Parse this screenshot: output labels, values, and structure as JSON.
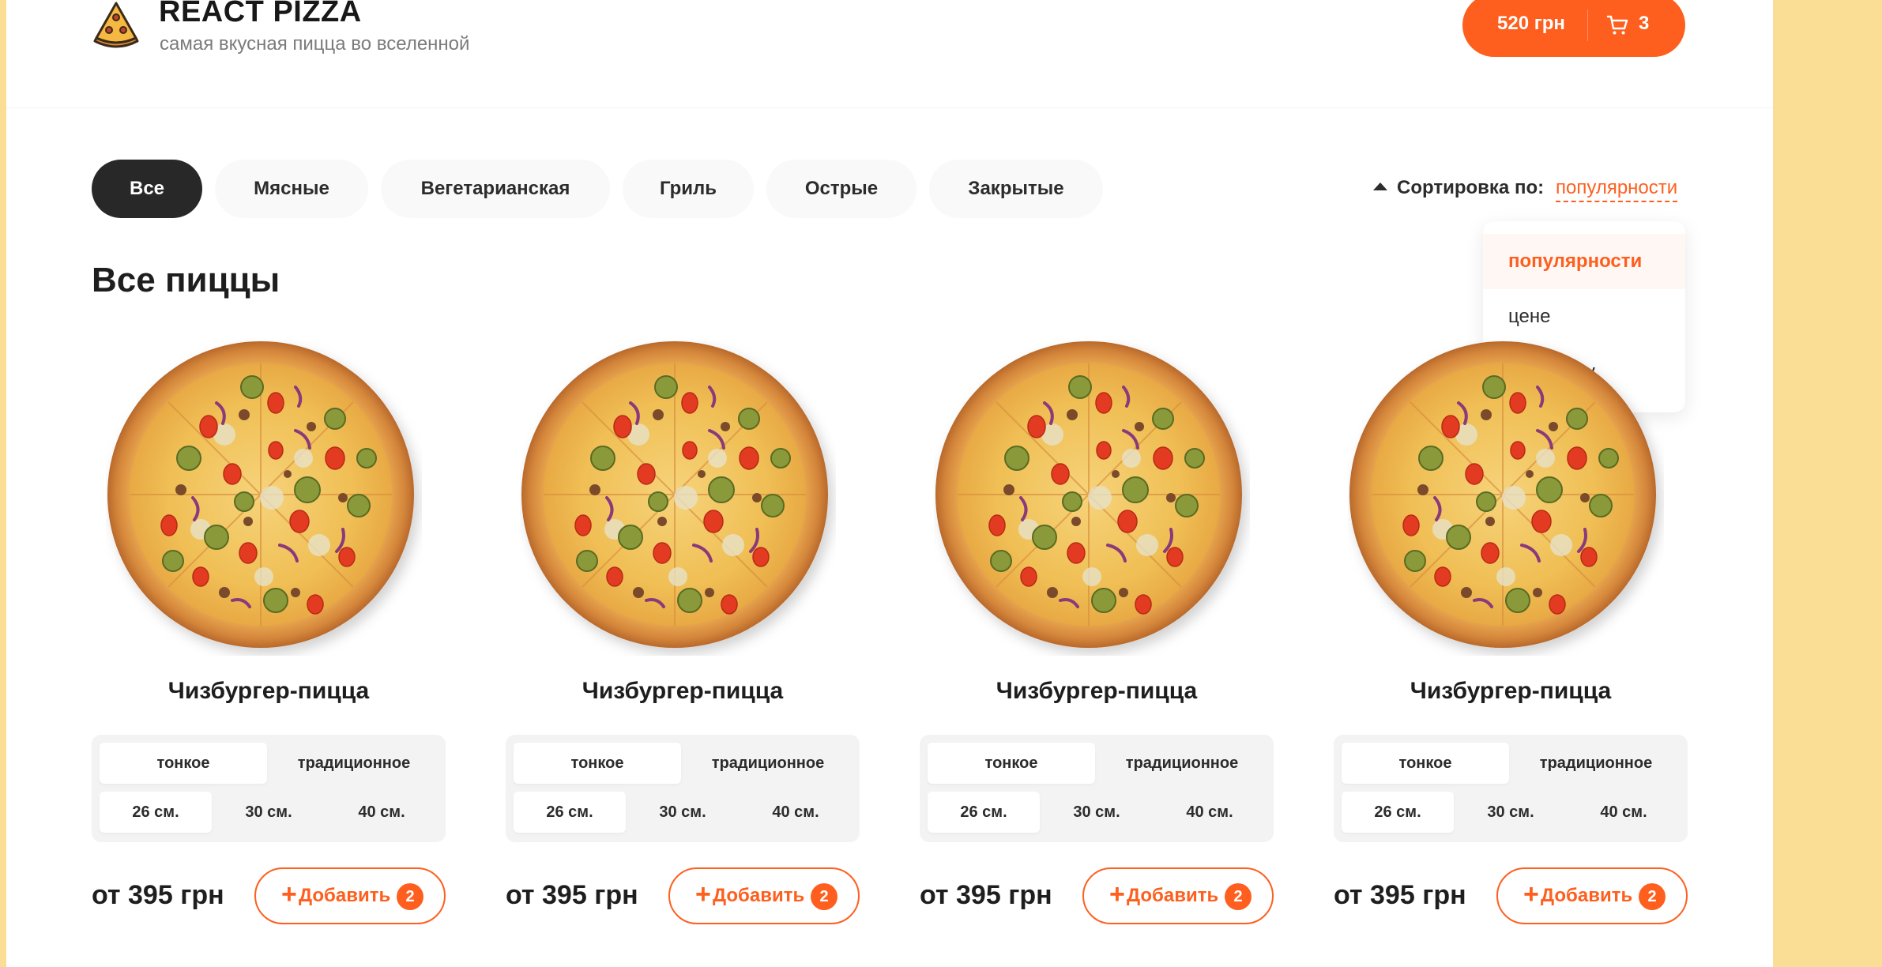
{
  "header": {
    "logo_icon": "pizza-slice-icon",
    "title": "REACT PIZZA",
    "subtitle": "самая вкусная пицца во вселенной",
    "cart": {
      "price": "520 грн",
      "count": "3",
      "icon": "cart-icon"
    }
  },
  "categories": [
    "Все",
    "Мясные",
    "Вегетарианская",
    "Гриль",
    "Острые",
    "Закрытые"
  ],
  "active_category": "Все",
  "sort": {
    "label": "Сортировка по:",
    "value": "популярности",
    "options": [
      "популярности",
      "цене",
      "алфавиту"
    ]
  },
  "section_title": "Все пиццы",
  "pizzas": [
    {
      "name": "Чизбургер-пицца",
      "types": [
        "тонкое",
        "традиционное"
      ],
      "sizes": [
        "26 см.",
        "30 см.",
        "40 см."
      ],
      "price": "от 395 грн",
      "add_label": "Добавить",
      "count": "2"
    },
    {
      "name": "Чизбургер-пицца",
      "types": [
        "тонкое",
        "традиционное"
      ],
      "sizes": [
        "26 см.",
        "30 см.",
        "40 см."
      ],
      "price": "от 395 грн",
      "add_label": "Добавить",
      "count": "2"
    },
    {
      "name": "Чизбургер-пицца",
      "types": [
        "тонкое",
        "традиционное"
      ],
      "sizes": [
        "26 см.",
        "30 см.",
        "40 см."
      ],
      "price": "от 395 грн",
      "add_label": "Добавить",
      "count": "2"
    },
    {
      "name": "Чизбургер-пицца",
      "types": [
        "тонкое",
        "традиционное"
      ],
      "sizes": [
        "26 см.",
        "30 см.",
        "40 см."
      ],
      "price": "от 395 грн",
      "add_label": "Добавить",
      "count": "2"
    }
  ],
  "colors": {
    "accent": "#fe5f1e",
    "dark": "#282828",
    "page_bg": "#fbde96"
  }
}
